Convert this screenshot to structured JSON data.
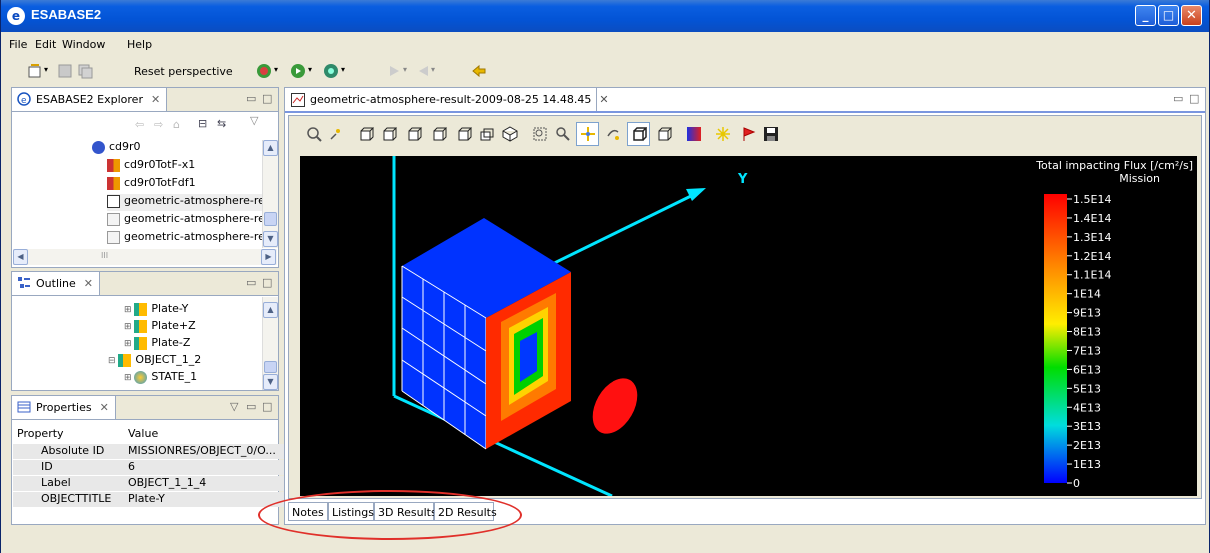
{
  "window": {
    "title": "ESABASE2"
  },
  "menu": [
    "File",
    "Edit",
    "Window",
    "Help"
  ],
  "toolbar": {
    "reset_perspective": "Reset perspective"
  },
  "explorer": {
    "title": "ESABASE2 Explorer",
    "items": [
      "cd9r0",
      "cd9r0TotF-x1",
      "cd9r0TotFdf1",
      "geometric-atmosphere-resu",
      "geometric-atmosphere-resu",
      "geometric-atmosphere-resu"
    ],
    "hscroll_mark": "III"
  },
  "outline": {
    "title": "Outline",
    "items": [
      "Plate-Y",
      "Plate+Z",
      "Plate-Z",
      "OBJECT_1_2",
      "STATE_1"
    ]
  },
  "properties": {
    "title": "Properties",
    "header_property": "Property",
    "header_value": "Value",
    "rows": [
      {
        "key": "Absolute ID",
        "value": "MISSIONRES/OBJECT_0/O..."
      },
      {
        "key": "ID",
        "value": "6"
      },
      {
        "key": "Label",
        "value": "OBJECT_1_1_4"
      },
      {
        "key": "OBJECTTITLE",
        "value": "Plate-Y"
      }
    ]
  },
  "editor": {
    "tab_title": "geometric-atmosphere-result-2009-08-25 14.48.45",
    "axis_label": "Y",
    "legend_title": "Total impacting Flux [/cm²/s]",
    "legend_subtitle": "Mission",
    "legend_ticks": [
      "1.5E14",
      "1.4E14",
      "1.3E14",
      "1.2E14",
      "1.1E14",
      "1E14",
      "9E13",
      "8E13",
      "7E13",
      "6E13",
      "5E13",
      "4E13",
      "3E13",
      "2E13",
      "1E13",
      "0"
    ]
  },
  "bottom_tabs": [
    "Notes",
    "Listings",
    "3D Results",
    "2D Results"
  ],
  "colors": {
    "title_bar": "#0054e3",
    "background": "#ece9d8",
    "highlight": "#e0302a",
    "axis": "#00e5ff"
  }
}
